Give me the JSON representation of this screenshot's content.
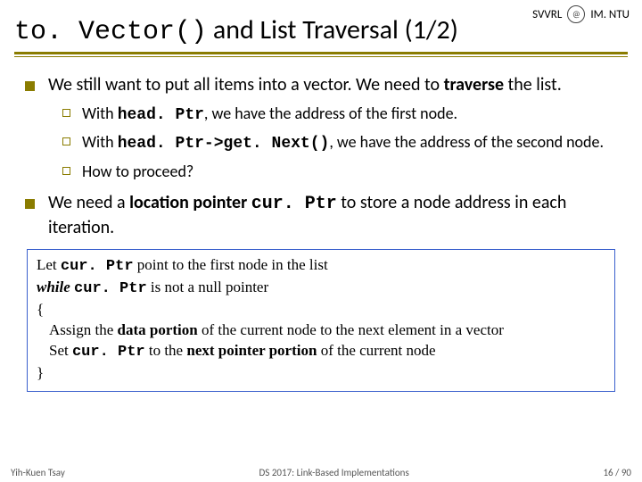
{
  "header": {
    "svvrl": "SVVRL",
    "affil": "IM. NTU",
    "title_code": "to. Vector()",
    "title_rest": " and List Traversal (1/2)"
  },
  "body": {
    "p1a": "We still want to put all items into a vector. We need to ",
    "p1b": "traverse",
    "p1c": " the list.",
    "s1a": "With ",
    "s1b": "head. Ptr",
    "s1c": ", we have the address of the first node.",
    "s2a": "With ",
    "s2b": "head. Ptr->get. Next()",
    "s2c": ", we have the address of the second node.",
    "s3": "How to proceed?",
    "p2a": "We need a ",
    "p2b": "location pointer",
    "p2c": " ",
    "p2d": "cur. Ptr",
    "p2e": " to store a node address in each iteration."
  },
  "pseudo": {
    "l1a": "Let ",
    "l1b": "cur. Ptr",
    "l1c": " point to the first node in the list",
    "l2a": "while",
    "l2b": " ",
    "l2c": "cur. Ptr",
    "l2d": " is not a null pointer",
    "l3": "{",
    "l4a": "Assign the ",
    "l4b": "data portion",
    "l4c": " of the current node to the next element in a vector",
    "l5a": "Set ",
    "l5b": "cur. Ptr",
    "l5c": " to the ",
    "l5d": "next pointer portion",
    "l5e": " of the current node",
    "l6": "}"
  },
  "footer": {
    "left": "Yih-Kuen Tsay",
    "center": "DS 2017: Link-Based Implementations",
    "right": "16 / 90"
  }
}
